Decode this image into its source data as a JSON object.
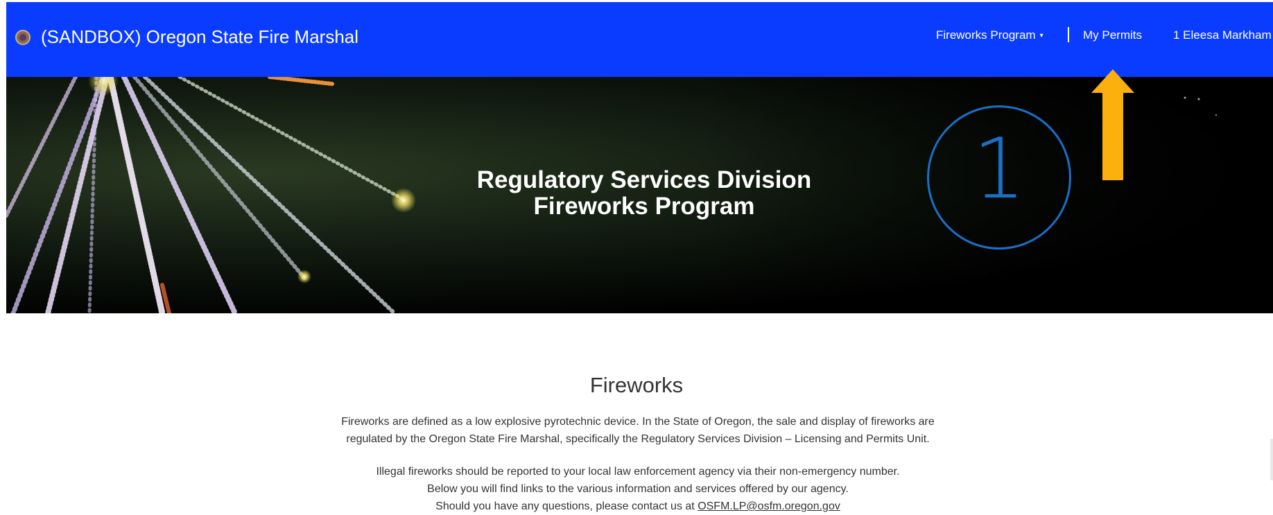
{
  "header": {
    "brand": "(SANDBOX) Oregon State Fire Marshal",
    "nav": {
      "fireworks_program": "Fireworks Program",
      "my_permits": "My Permits",
      "user": "1 Eleesa Markham"
    },
    "background_color": "#0a3cff"
  },
  "hero": {
    "title_line1": "Regulatory Services Division",
    "title_line2": "Fireworks Program"
  },
  "annotation": {
    "number": "1",
    "circle_color": "#1a6fc7",
    "arrow_color": "#fbb00e"
  },
  "content": {
    "title": "Fireworks",
    "para1_line1": "Fireworks are defined as a low explosive pyrotechnic device. In the State of Oregon, the sale and display of fireworks are",
    "para1_line2": "regulated by the Oregon State Fire Marshal, specifically the Regulatory Services Division – Licensing and Permits Unit.",
    "para2_line1": "Illegal fireworks should be reported to your local law enforcement agency via their non-emergency number.",
    "para2_line2": "Below you will find links to the various information and services offered by our agency.",
    "para2_line3_prefix": "Should you have any questions, please contact us at",
    "contact_email": "OSFM.LP@osfm.oregon.gov"
  }
}
